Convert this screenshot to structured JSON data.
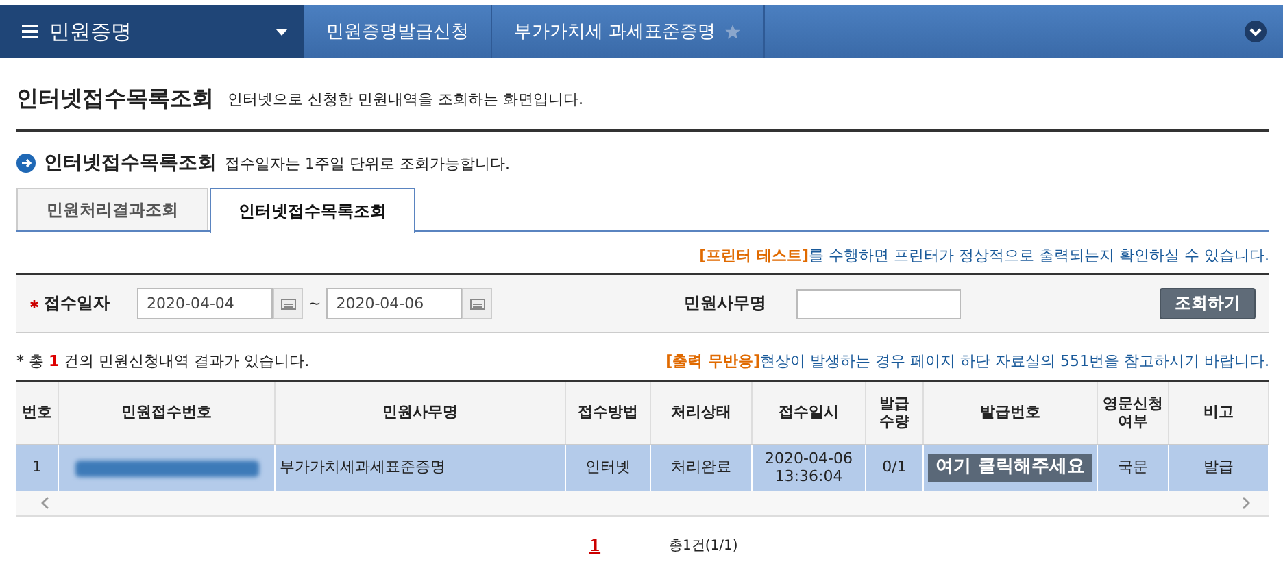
{
  "topbar": {
    "menu_title": "민원증명",
    "breadcrumbs": [
      {
        "label": "민원증명발급신청"
      },
      {
        "label": "부가가치세 과세표준증명",
        "starred": false
      }
    ]
  },
  "page": {
    "title": "인터넷접수목록조회",
    "description": "인터넷으로 신청한 민원내역을 조회하는 화면입니다."
  },
  "section": {
    "title": "인터넷접수목록조회",
    "note": "접수일자는 1주일 단위로 조회가능합니다."
  },
  "tabs": [
    {
      "label": "민원처리결과조회",
      "selected": false
    },
    {
      "label": "인터넷접수목록조회",
      "selected": true
    }
  ],
  "printer_notice": {
    "link": "[프린터 테스트]",
    "text": "를 수행하면 프린터가 정상적으로 출력되는지 확인하실 수 있습니다."
  },
  "search": {
    "date_label": "접수일자",
    "required": true,
    "date_from": "2020-04-04",
    "date_to": "2020-04-06",
    "range_sep": "~",
    "name_label": "민원사무명",
    "button": "조회하기"
  },
  "result_summary": {
    "prefix": "* 총",
    "count": "1",
    "suffix": "건의 민원신청내역 결과가 있습니다."
  },
  "output_notice": {
    "link": "[출력 무반응]",
    "text": "현상이 발생하는 경우 페이지 하단 자료실의 551번을 참고하시기 바랍니다."
  },
  "table": {
    "columns": [
      "번호",
      "민원접수번호",
      "민원사무명",
      "접수방법",
      "처리상태",
      "접수일시",
      "발급\n수량",
      "발급번호",
      "영문신청\n여부",
      "비고"
    ],
    "rows": [
      {
        "selected": true,
        "cells": [
          "1",
          {
            "kind": "redacted"
          },
          "부가가치세과세표준증명",
          "인터넷",
          "처리완료",
          "2020-04-06\n13:36:04",
          "0/1",
          {
            "kind": "tooltip",
            "text": "여기 클릭해주세요"
          },
          "국문",
          "발급"
        ]
      }
    ]
  },
  "pagination": {
    "pages": [
      {
        "label": "1",
        "selected": true
      }
    ],
    "total": "총1건(1/1)"
  }
}
